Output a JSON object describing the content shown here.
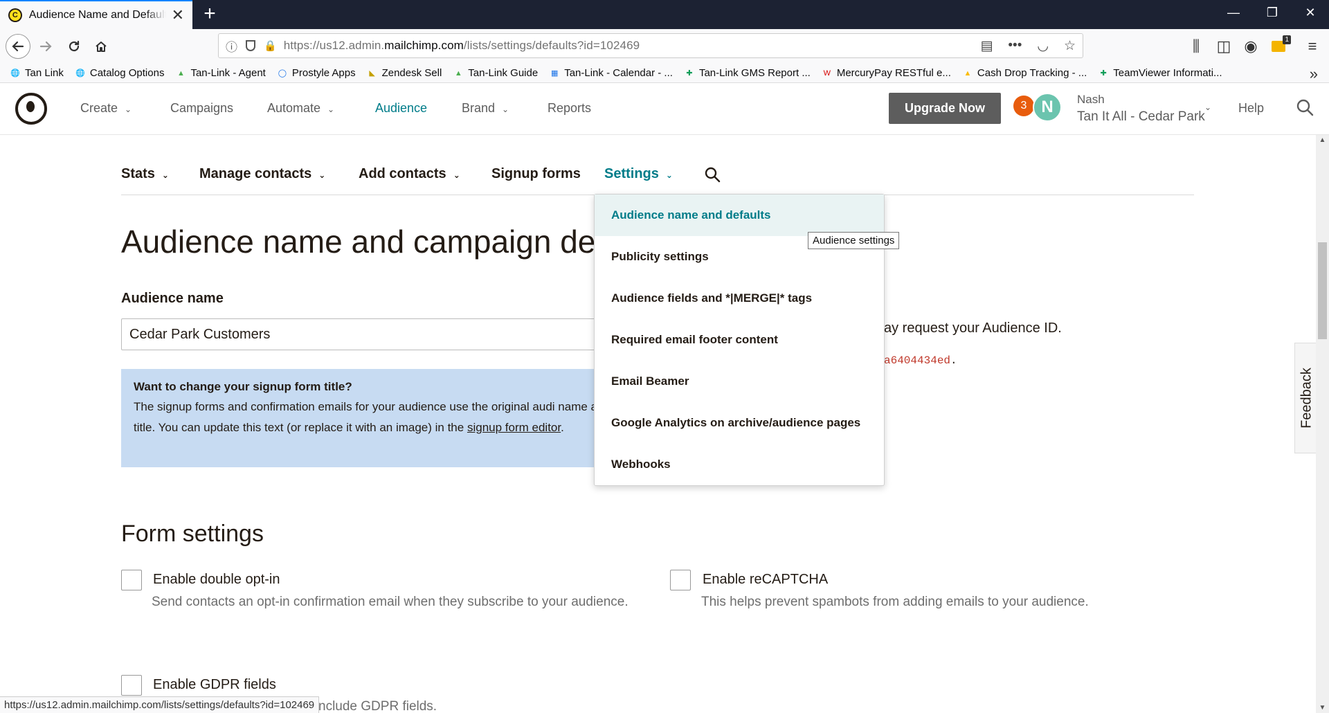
{
  "browser": {
    "tab_title": "Audience Name and Defaults for",
    "new_tab": "+",
    "url_host_prefix": "https://us12.admin.",
    "url_host": "mailchimp.com",
    "url_path": "/lists/settings/defaults?id=102469",
    "status_url": "https://us12.admin.mailchimp.com/lists/settings/defaults?id=102469",
    "toolbar_badge": "1"
  },
  "bookmarks": [
    {
      "label": "Tan Link",
      "icon": "globe-icon",
      "color": "#444444"
    },
    {
      "label": "Catalog Options",
      "icon": "globe-icon",
      "color": "#444444"
    },
    {
      "label": "Tan-Link - Agent",
      "icon": "tanlink-icon",
      "color": "#4caf50"
    },
    {
      "label": "Prostyle Apps",
      "icon": "circle-icon",
      "color": "#1a73e8"
    },
    {
      "label": "Zendesk Sell",
      "icon": "zendesk-icon",
      "color": "#c4a000"
    },
    {
      "label": "Tan-Link Guide",
      "icon": "tanlink-icon",
      "color": "#4caf50"
    },
    {
      "label": "Tan-Link - Calendar - ...",
      "icon": "calendar-icon",
      "color": "#1a73e8"
    },
    {
      "label": "Tan-Link GMS Report ...",
      "icon": "sheets-icon",
      "color": "#0f9d58"
    },
    {
      "label": "MercuryPay RESTful e...",
      "icon": "mercury-icon",
      "color": "#d50000"
    },
    {
      "label": "Cash Drop Tracking - ...",
      "icon": "drive-icon",
      "color": "#fbbc04"
    },
    {
      "label": "TeamViewer Informati...",
      "icon": "sheets-icon",
      "color": "#0f9d58"
    }
  ],
  "mc_nav": {
    "create": "Create",
    "campaigns": "Campaigns",
    "automate": "Automate",
    "audience": "Audience",
    "brand": "Brand",
    "reports": "Reports",
    "upgrade": "Upgrade Now",
    "notifications": "3",
    "avatar_initial": "N",
    "user_name": "Nash",
    "org_name": "Tan It All - Cedar Park",
    "help": "Help"
  },
  "subnav": {
    "stats": "Stats",
    "manage_contacts": "Manage contacts",
    "add_contacts": "Add contacts",
    "signup_forms": "Signup forms",
    "settings": "Settings"
  },
  "page": {
    "title": "Audience name and campaign de",
    "audience_name_label": "Audience name",
    "audience_name_value": "Cedar Park Customers",
    "info_title": "Want to change your signup form title?",
    "info_text": "The signup forms and confirmation emails for your audience use the original audi name as a title. You can update this text (or replace it with an image) in the",
    "info_link": "signup form editor",
    "info_period": ".",
    "audience_id_text": "ay request your Audience ID.",
    "audience_id_code": "a6404434ed",
    "audience_id_period": ".",
    "form_settings_title": "Form settings",
    "double_optin_label": "Enable double opt-in",
    "double_optin_desc": "Send contacts an opt-in confirmation email when they subscribe to your audience.",
    "recaptcha_label": "Enable reCAPTCHA",
    "recaptcha_desc": "This helps prevent spambots from adding emails to your audience.",
    "gdpr_label": "Enable GDPR fields",
    "gdpr_desc": "nclude GDPR fields."
  },
  "dropdown": {
    "items": [
      "Audience name and defaults",
      "Publicity settings",
      "Audience fields and *|MERGE|* tags",
      "Required email footer content",
      "Email Beamer",
      "Google Analytics on archive/audience pages",
      "Webhooks"
    ],
    "tooltip": "Audience settings"
  },
  "feedback": "Feedback",
  "colors": {
    "accent": "#007c89",
    "upgrade_bg": "#5d5d5d",
    "info_bg": "#c7dbf2",
    "badge": "#e85c0d",
    "avatar": "#6bc4ae"
  }
}
